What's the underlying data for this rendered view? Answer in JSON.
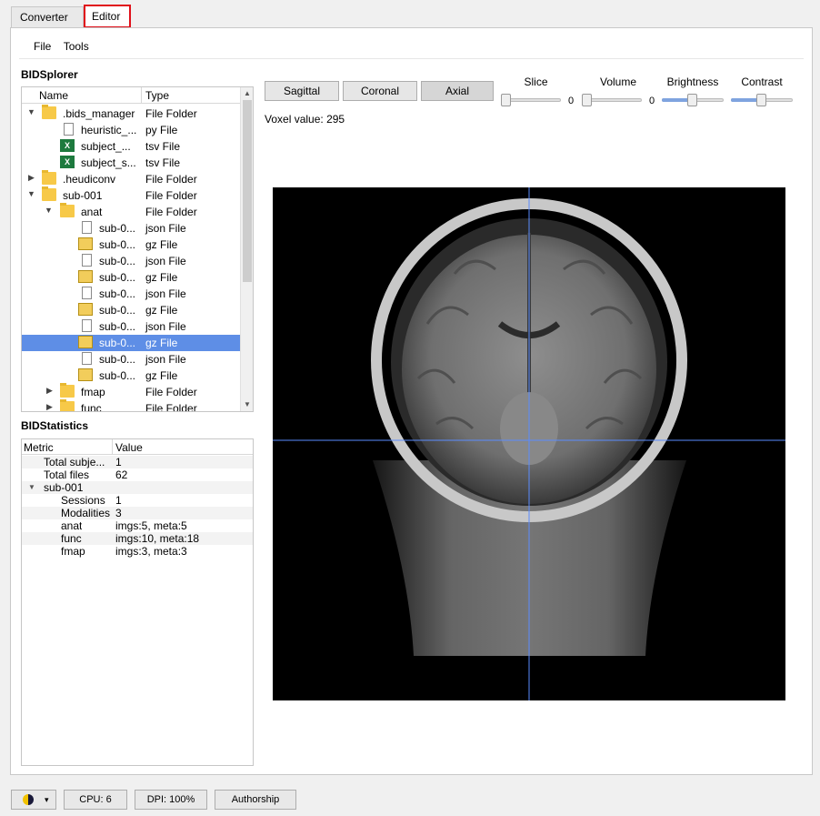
{
  "tabs": [
    {
      "label": "Converter"
    },
    {
      "label": "Editor"
    }
  ],
  "menu": {
    "file": "File",
    "tools": "Tools"
  },
  "explorer": {
    "title": "BIDSplorer",
    "columns": {
      "name": "Name",
      "type": "Type"
    },
    "rows": [
      {
        "name": ".bids_manager",
        "type": "File Folder"
      },
      {
        "name": "heuristic_...",
        "type": "py File"
      },
      {
        "name": "subject_...",
        "type": "tsv File"
      },
      {
        "name": "subject_s...",
        "type": "tsv File"
      },
      {
        "name": ".heudiconv",
        "type": "File Folder"
      },
      {
        "name": "sub-001",
        "type": "File Folder"
      },
      {
        "name": "anat",
        "type": "File Folder"
      },
      {
        "name": "sub-0...",
        "type": "json File"
      },
      {
        "name": "sub-0...",
        "type": "gz File"
      },
      {
        "name": "sub-0...",
        "type": "json File"
      },
      {
        "name": "sub-0...",
        "type": "gz File"
      },
      {
        "name": "sub-0...",
        "type": "json File"
      },
      {
        "name": "sub-0...",
        "type": "gz File"
      },
      {
        "name": "sub-0...",
        "type": "json File"
      },
      {
        "name": "sub-0...",
        "type": "gz File"
      },
      {
        "name": "sub-0...",
        "type": "json File"
      },
      {
        "name": "sub-0...",
        "type": "gz File"
      },
      {
        "name": "fmap",
        "type": "File Folder"
      },
      {
        "name": "func",
        "type": "File Folder"
      }
    ]
  },
  "statistics": {
    "title": "BIDStatistics",
    "columns": {
      "metric": "Metric",
      "value": "Value"
    },
    "rows": [
      {
        "metric": "Total subje...",
        "value": "1"
      },
      {
        "metric": "Total files",
        "value": "62"
      },
      {
        "metric": "sub-001",
        "value": ""
      },
      {
        "metric": "Sessions",
        "value": "1"
      },
      {
        "metric": "Modalities",
        "value": "3"
      },
      {
        "metric": "anat",
        "value": "imgs:5, meta:5"
      },
      {
        "metric": "func",
        "value": "imgs:10, meta:18"
      },
      {
        "metric": "fmap",
        "value": "imgs:3, meta:3"
      }
    ]
  },
  "viewer": {
    "buttons": {
      "sagittal": "Sagittal",
      "coronal": "Coronal",
      "axial": "Axial"
    },
    "voxel_label": "Voxel value:",
    "voxel_value": "295",
    "sliders": {
      "slice": {
        "label": "Slice",
        "value": "0"
      },
      "volume": {
        "label": "Volume",
        "value": "0"
      },
      "brightness": {
        "label": "Brightness"
      },
      "contrast": {
        "label": "Contrast"
      }
    }
  },
  "status": {
    "theme_arrow": "▾",
    "cpu": "CPU: 6",
    "dpi": "DPI: 100%",
    "authorship": "Authorship"
  }
}
